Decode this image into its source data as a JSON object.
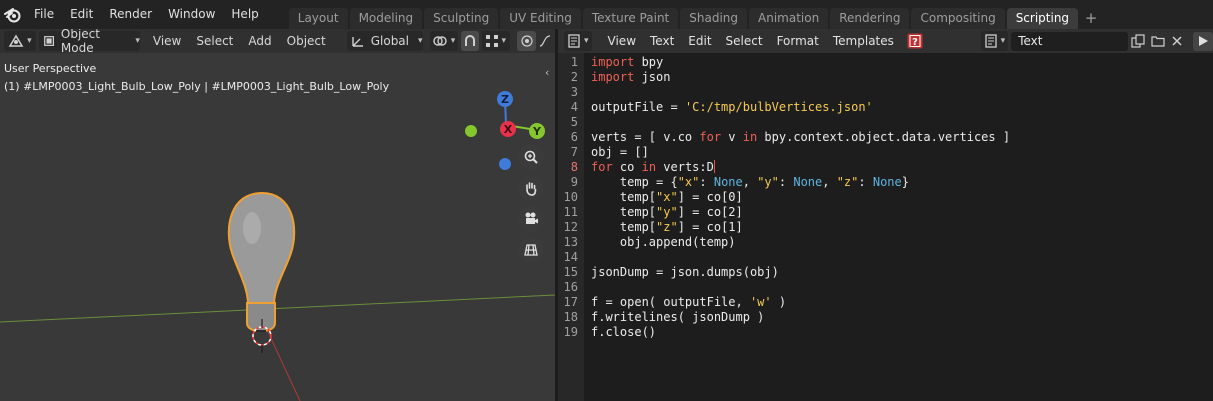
{
  "top_bar": {
    "logo_icon": "blender-logo-icon",
    "menus": [
      "File",
      "Edit",
      "Render",
      "Window",
      "Help"
    ],
    "tabs": [
      "Layout",
      "Modeling",
      "Sculpting",
      "UV Editing",
      "Texture Paint",
      "Shading",
      "Animation",
      "Rendering",
      "Compositing",
      "Scripting"
    ],
    "active_tab": "Scripting",
    "add_tab_label": "+"
  },
  "viewport": {
    "editor_type_icon": "3d-viewport-icon",
    "mode_label": "Object Mode",
    "menus": [
      "View",
      "Select",
      "Add",
      "Object"
    ],
    "transform_orientation": "Global",
    "info_line1": "User Perspective",
    "info_line2": "(1) #LMP0003_Light_Bulb_Low_Poly | #LMP0003_Light_Bulb_Low_Poly",
    "gizmo_axes": {
      "z": "Z",
      "x": "X",
      "y": "Y"
    },
    "axis_colors": {
      "x": "#e8314a",
      "y": "#86c72f",
      "z": "#3f7bd8"
    },
    "nav_icons": [
      "zoom-icon",
      "pan-hand-icon",
      "camera-icon",
      "grid-icon"
    ],
    "collapse_label": "‹"
  },
  "text_editor": {
    "editor_type_icon": "text-editor-icon",
    "menus": [
      "View",
      "Text",
      "Edit",
      "Select",
      "Format",
      "Templates"
    ],
    "text_name": "Text",
    "code_lines": [
      [
        {
          "t": "import",
          "c": "kw"
        },
        {
          "t": " bpy",
          "c": "op"
        }
      ],
      [
        {
          "t": "import",
          "c": "kw"
        },
        {
          "t": " json",
          "c": "op"
        }
      ],
      [],
      [
        {
          "t": "outputFile = ",
          "c": "op"
        },
        {
          "t": "'C:/tmp/bulbVertices.json'",
          "c": "str"
        }
      ],
      [],
      [
        {
          "t": "verts = [ v.co ",
          "c": "op"
        },
        {
          "t": "for",
          "c": "kw"
        },
        {
          "t": " v ",
          "c": "op"
        },
        {
          "t": "in",
          "c": "kw"
        },
        {
          "t": " bpy.context.object.data.vertices ]",
          "c": "op"
        }
      ],
      [
        {
          "t": "obj = []",
          "c": "op"
        }
      ],
      [
        {
          "t": "for",
          "c": "kw"
        },
        {
          "t": " co ",
          "c": "op"
        },
        {
          "t": "in",
          "c": "kw"
        },
        {
          "t": " verts:D",
          "c": "op"
        }
      ],
      [
        {
          "t": "    temp = {",
          "c": "op"
        },
        {
          "t": "\"x\"",
          "c": "str"
        },
        {
          "t": ": ",
          "c": "op"
        },
        {
          "t": "None",
          "c": "bi"
        },
        {
          "t": ", ",
          "c": "op"
        },
        {
          "t": "\"y\"",
          "c": "str"
        },
        {
          "t": ": ",
          "c": "op"
        },
        {
          "t": "None",
          "c": "bi"
        },
        {
          "t": ", ",
          "c": "op"
        },
        {
          "t": "\"z\"",
          "c": "str"
        },
        {
          "t": ": ",
          "c": "op"
        },
        {
          "t": "None",
          "c": "bi"
        },
        {
          "t": "}",
          "c": "op"
        }
      ],
      [
        {
          "t": "    temp[",
          "c": "op"
        },
        {
          "t": "\"x\"",
          "c": "str"
        },
        {
          "t": "] = co[0]",
          "c": "op"
        }
      ],
      [
        {
          "t": "    temp[",
          "c": "op"
        },
        {
          "t": "\"y\"",
          "c": "str"
        },
        {
          "t": "] = co[2]",
          "c": "op"
        }
      ],
      [
        {
          "t": "    temp[",
          "c": "op"
        },
        {
          "t": "\"z\"",
          "c": "str"
        },
        {
          "t": "] = co[1]",
          "c": "op"
        }
      ],
      [
        {
          "t": "    obj.append(temp)",
          "c": "op"
        }
      ],
      [],
      [
        {
          "t": "jsonDump = json.dumps(obj)",
          "c": "op"
        }
      ],
      [],
      [
        {
          "t": "f = open( outputFile, ",
          "c": "op"
        },
        {
          "t": "'w'",
          "c": "str"
        },
        {
          "t": " )",
          "c": "op"
        }
      ],
      [
        {
          "t": "f.writelines( jsonDump )",
          "c": "op"
        }
      ],
      [
        {
          "t": "f.close()",
          "c": "op"
        }
      ]
    ],
    "current_line": 8
  }
}
